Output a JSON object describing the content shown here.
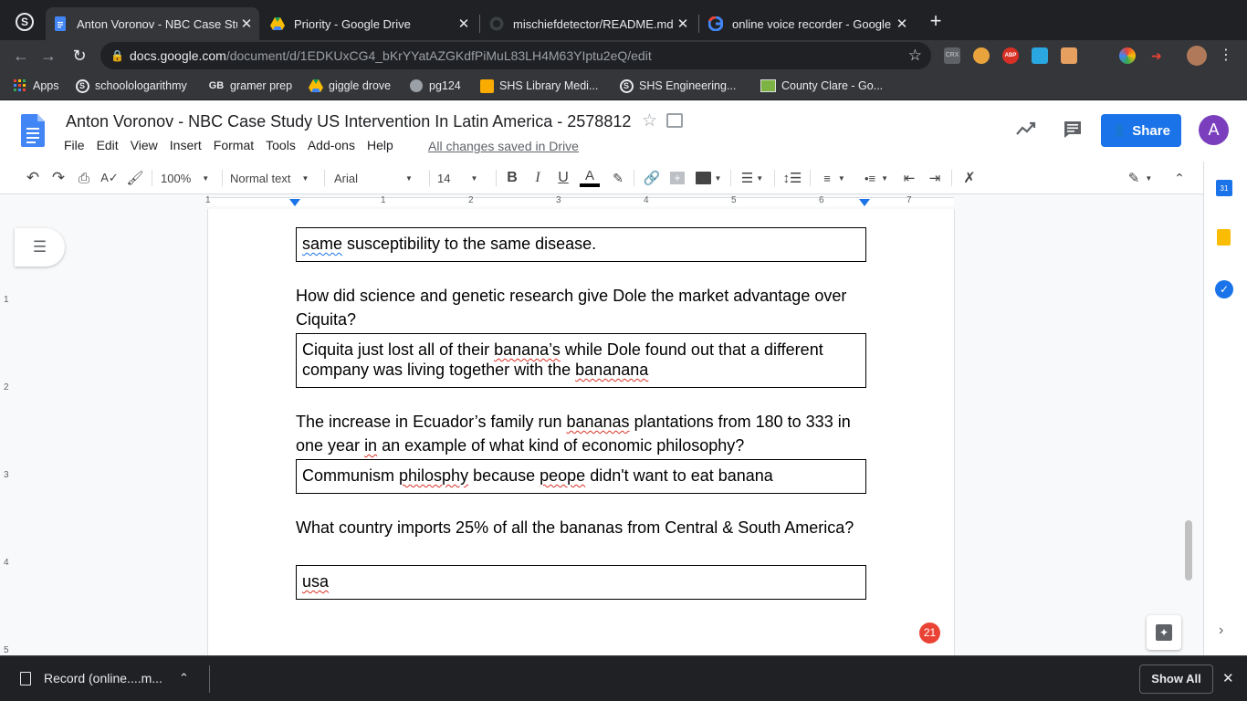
{
  "browser": {
    "tabs": [
      {
        "title": "Anton Voronov - NBC Case Stu",
        "active": true
      },
      {
        "title": "Priority - Google Drive",
        "active": false
      },
      {
        "title": "mischiefdetector/README.md",
        "active": false
      },
      {
        "title": "online voice recorder - Google",
        "active": false
      }
    ],
    "new_tab_symbol": "+",
    "close_symbol": "✕",
    "url_host": "docs.google.com",
    "url_path": "/document/d/1EDKUxCG4_bKrYYatAZGKdfPiMuL83LH4M63YIptu2eQ/edit",
    "extensions": [
      {
        "label": "CRX"
      },
      {
        "label": "ABP"
      }
    ],
    "bookmarks": [
      {
        "label": "Apps"
      },
      {
        "label": "schoolologarithmy"
      },
      {
        "label": "gramer prep"
      },
      {
        "label": "giggle drove"
      },
      {
        "label": "pg124"
      },
      {
        "label": "SHS Library Medi..."
      },
      {
        "label": "SHS Engineering..."
      },
      {
        "label": "County Clare - Go..."
      }
    ]
  },
  "docs": {
    "title": "Anton Voronov - NBC Case Study US Intervention In Latin America - 2578812",
    "menu": [
      "File",
      "Edit",
      "View",
      "Insert",
      "Format",
      "Tools",
      "Add-ons",
      "Help"
    ],
    "save_status": "All changes saved in Drive",
    "share_label": "Share",
    "avatar_letter": "A"
  },
  "toolbar": {
    "zoom": "100%",
    "style": "Normal text",
    "font": "Arial",
    "font_size": "14",
    "bold": "B",
    "italic": "I",
    "underline": "U",
    "text_color": "A"
  },
  "ruler": {
    "marks": [
      "1",
      "1",
      "2",
      "3",
      "4",
      "5",
      "6",
      "7"
    ],
    "vmarks": [
      "1",
      "2",
      "3",
      "4",
      "5"
    ]
  },
  "document": {
    "box1": "same susceptibility to the same disease.",
    "q2": "How did science and genetic research give Dole the market advantage over Ciquita?",
    "a2_parts": [
      "Ciquita just lost all of their ",
      "banana’s",
      " while Dole found out that a different company was living together with the ",
      "bananana"
    ],
    "q3_parts": [
      "The increase in Ecuador’s family run ",
      "bananas",
      " plantations from 180 to 333 in one year ",
      "in",
      " an example of what kind of economic philosophy?"
    ],
    "a3_parts": [
      "Communism ",
      "philosphy",
      " because ",
      "peope",
      " didn't want to eat banana"
    ],
    "q4": "What country imports 25% of all the bananas from Central & South America?",
    "a4": "usa"
  },
  "notifications": {
    "comment_count": "21"
  },
  "downloads": {
    "item": "Record (online....m...",
    "show_all": "Show All",
    "close_symbol": "✕"
  },
  "colors": {
    "share_blue": "#1a73e8",
    "avatar_purple": "#7b3fbe",
    "badge_red": "#ea4335",
    "chrome_dark": "#202124",
    "spell_red": "#d93025"
  }
}
